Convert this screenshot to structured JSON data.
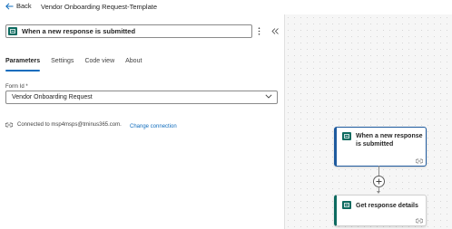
{
  "topbar": {
    "back_label": "Back",
    "title": "Vendor Onboarding Request-Template"
  },
  "panel": {
    "trigger_name": "When a new response is submitted",
    "tabs": [
      {
        "label": "Parameters",
        "active": true
      },
      {
        "label": "Settings",
        "active": false
      },
      {
        "label": "Code view",
        "active": false
      },
      {
        "label": "About",
        "active": false
      }
    ],
    "form_id": {
      "label": "Form Id *",
      "value": "Vendor Onboarding Request"
    },
    "connection": {
      "text": "Connected to msp4msps@tminus365.com.",
      "change_link": "Change connection"
    }
  },
  "canvas": {
    "cards": [
      {
        "title": "When a new response is submitted",
        "selected": true
      },
      {
        "title": "Get response details",
        "selected": false
      }
    ]
  },
  "colors": {
    "accent": "#0f6cbd",
    "forms_icon": "#0d6b60",
    "selected_border": "#1e5a9e"
  },
  "icons": [
    "back-arrow-icon",
    "forms-icon",
    "more-vertical-icon",
    "collapse-double-chevron-icon",
    "chevron-down-icon",
    "link-icon",
    "plus-icon"
  ]
}
